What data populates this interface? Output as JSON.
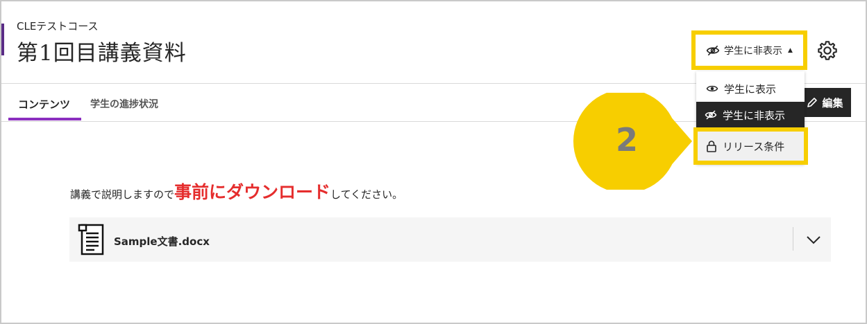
{
  "header": {
    "course_name": "CLEテストコース",
    "page_title": "第1回目講義資料"
  },
  "visibility": {
    "current_label": "学生に非表示",
    "caret": "▲"
  },
  "tabs": [
    {
      "label": "コンテンツ"
    },
    {
      "label": "学生の進捗状況"
    }
  ],
  "edit_button": {
    "label": "編集"
  },
  "visibility_menu": {
    "items": [
      {
        "label": "学生に表示",
        "icon": "eye-icon"
      },
      {
        "label": "学生に非表示",
        "icon": "eye-slash-icon"
      },
      {
        "label": "リリース条件",
        "icon": "lock-icon"
      }
    ]
  },
  "callout": {
    "step": "2",
    "color": "#f7ce00"
  },
  "content": {
    "instruction_prefix": "講義で説明しますので",
    "instruction_emphasis": "事前にダウンロード",
    "instruction_suffix": "してください。",
    "file_name": "Sample文書.docx"
  },
  "colors": {
    "accent": "#8b2fbf",
    "highlight": "#f7ce00",
    "emphasis": "#e52d2d"
  }
}
